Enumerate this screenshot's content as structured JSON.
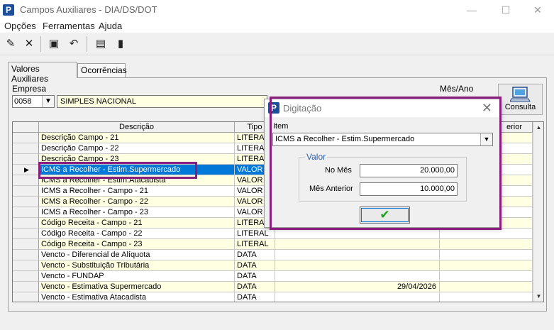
{
  "window": {
    "title": "Campos Auxiliares - DIA/DS/DOT",
    "app_icon_letter": "P",
    "minimize_glyph": "—",
    "maximize_glyph": "☐",
    "close_glyph": "✕"
  },
  "menu": [
    "Opções",
    "Ferramentas",
    "Ajuda"
  ],
  "toolbar": {
    "icons": [
      "edit-icon",
      "delete-icon",
      "save-icon",
      "undo-icon",
      "report-icon",
      "exit-icon"
    ],
    "glyphs": [
      "✎",
      "✕",
      "▣",
      "↶",
      "▤",
      "▮"
    ]
  },
  "tabs": [
    "Valores Auxiliares",
    "Ocorrências"
  ],
  "form": {
    "empresa_label": "Empresa",
    "empresa_code": "0058",
    "empresa_name": "SIMPLES NACIONAL",
    "mes_ano_label": "Mês/Ano",
    "consulta_label": "Consulta"
  },
  "grid": {
    "headers": [
      "Descrição",
      "Tipo",
      "erior"
    ],
    "rows": [
      {
        "descricao": "Descrição Campo - 21",
        "tipo": "LITERAL",
        "valor": ""
      },
      {
        "descricao": "Descrição Campo - 22",
        "tipo": "LITERAL",
        "valor": ""
      },
      {
        "descricao": "Descrição Campo - 23",
        "tipo": "LITERAL",
        "valor": ""
      },
      {
        "descricao": "ICMS a Recolher - Estim.Supermercado",
        "tipo": "VALOR",
        "valor": ""
      },
      {
        "descricao": "ICMS a Recolher - Estim.Atacadista",
        "tipo": "VALOR",
        "valor": ""
      },
      {
        "descricao": "ICMS a Recolher - Campo - 21",
        "tipo": "VALOR",
        "valor": ""
      },
      {
        "descricao": "ICMS a Recolher - Campo - 22",
        "tipo": "VALOR",
        "valor": ""
      },
      {
        "descricao": "ICMS a Recolher - Campo - 23",
        "tipo": "VALOR",
        "valor": ""
      },
      {
        "descricao": "Código Receita  - Campo - 21",
        "tipo": "LITERAL",
        "valor": ""
      },
      {
        "descricao": "Código Receita  - Campo - 22",
        "tipo": "LITERAL",
        "valor": ""
      },
      {
        "descricao": "Código Receita  - Campo - 23",
        "tipo": "LITERAL",
        "valor": ""
      },
      {
        "descricao": "Vencto - Diferencial de Alíquota",
        "tipo": "DATA",
        "valor": ""
      },
      {
        "descricao": "Vencto - Substituição Tributária",
        "tipo": "DATA",
        "valor": ""
      },
      {
        "descricao": "Vencto - FUNDAP",
        "tipo": "DATA",
        "valor": ""
      },
      {
        "descricao": "Vencto - Estimativa Supermercado",
        "tipo": "DATA",
        "valor": "29/04/2026"
      },
      {
        "descricao": "Vencto - Estimativa Atacadista",
        "tipo": "DATA",
        "valor": ""
      }
    ],
    "selected_row_marker": "▶"
  },
  "dialog": {
    "title": "Digitação",
    "item_label": "Item",
    "item_value": "ICMS a Recolher - Estim.Supermercado",
    "group_title": "Valor",
    "no_mes_label": "No Mês",
    "no_mes_value": "20.000,00",
    "mes_anterior_label": "Mês Anterior",
    "mes_anterior_value": "10.000,00",
    "ok_glyph": "✔",
    "close_glyph": "✕"
  },
  "colors": {
    "highlight_frame": "#8a1e7e",
    "selection": "#0078d7",
    "row_yellow": "#ffffe1"
  }
}
